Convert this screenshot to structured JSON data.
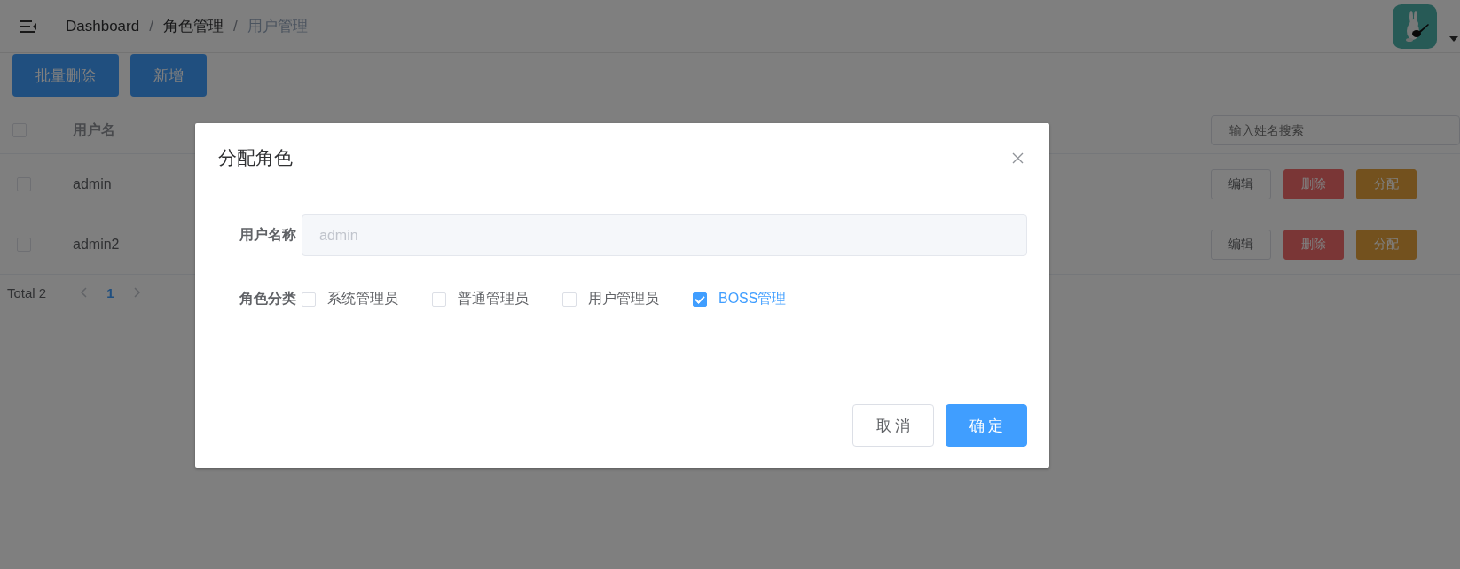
{
  "header": {
    "breadcrumb": [
      {
        "label": "Dashboard",
        "current": false
      },
      {
        "separator": "/",
        "label": "角色管理",
        "current": false
      },
      {
        "separator": "/",
        "label": "用户管理",
        "current": true
      }
    ]
  },
  "toolbar": {
    "buttons": [
      {
        "label": "批量删除"
      },
      {
        "label": "新增"
      }
    ]
  },
  "table": {
    "select_all_checked": false,
    "columns": [
      "用户名"
    ],
    "search": {
      "placeholder": "输入姓名搜索"
    },
    "rows": [
      {
        "checked": false,
        "username": "admin",
        "actions": [
          {
            "label": "编辑",
            "kind": "default"
          },
          {
            "label": "删除",
            "kind": "danger"
          },
          {
            "label": "分配",
            "kind": "warning"
          }
        ]
      },
      {
        "checked": false,
        "username": "admin2",
        "actions": [
          {
            "label": "编辑",
            "kind": "default"
          },
          {
            "label": "删除",
            "kind": "danger"
          },
          {
            "label": "分配",
            "kind": "warning"
          }
        ]
      }
    ]
  },
  "pagination": {
    "total": "Total 2",
    "pages": [
      {
        "label": "1",
        "selected": true
      }
    ]
  },
  "dialog": {
    "title": "分配角色",
    "username": {
      "label": "用户名称",
      "value": "admin",
      "disabled": true
    },
    "roles": {
      "label": "角色分类",
      "options": [
        {
          "label": "系统管理员",
          "checked": false
        },
        {
          "label": "普通管理员",
          "checked": false
        },
        {
          "label": "用户管理员",
          "checked": false
        },
        {
          "label": "BOSS管理",
          "checked": true
        }
      ]
    },
    "buttons": [
      {
        "label": "取 消",
        "kind": "default"
      },
      {
        "label": "确 定",
        "kind": "primary"
      }
    ]
  }
}
